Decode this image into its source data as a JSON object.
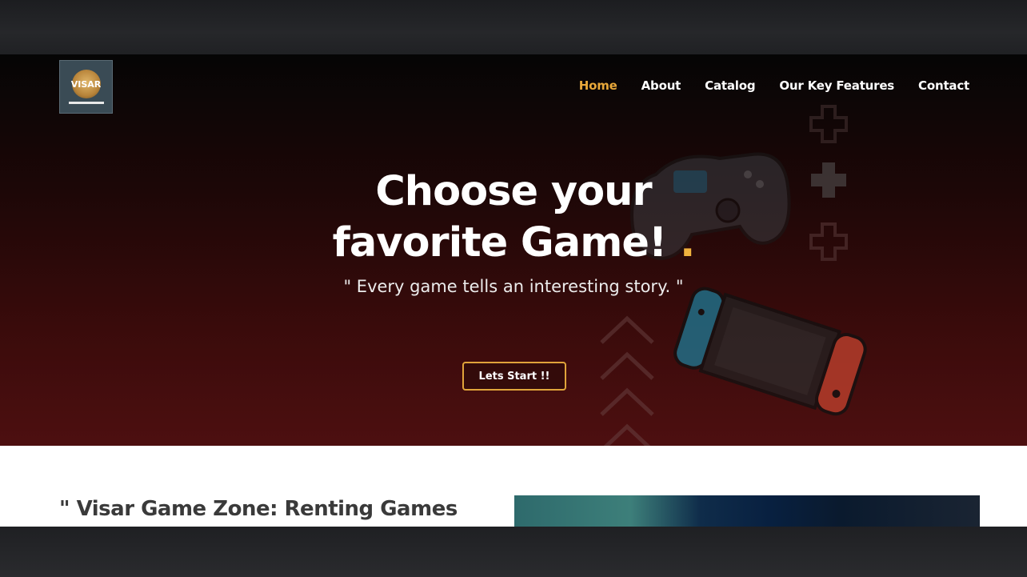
{
  "logo": {
    "text": "VISAR",
    "icon": "logo-badge"
  },
  "nav": {
    "items": [
      {
        "label": "Home",
        "active": true
      },
      {
        "label": "About",
        "active": false
      },
      {
        "label": "Catalog",
        "active": false
      },
      {
        "label": "Our Key Features",
        "active": false
      },
      {
        "label": "Contact",
        "active": false
      }
    ]
  },
  "hero": {
    "title_line1": "Choose your",
    "title_line2": "favorite Game!",
    "title_dot": ".",
    "subtitle": "\" Every game tells an interesting story. \"",
    "cta_label": "Lets Start !!",
    "decor_icons": [
      "gamepad-icon",
      "handheld-console-icon",
      "dpad-cross-icon",
      "chevron-up-icon"
    ]
  },
  "about": {
    "heading": "\" Visar Game Zone: Renting Games"
  },
  "colors": {
    "accent": "#e8a83a",
    "hero_top": "#050505",
    "hero_bottom": "#4d0f10",
    "heading_text": "#3a3a3a"
  }
}
